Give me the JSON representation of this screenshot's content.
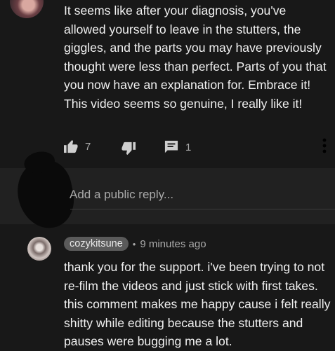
{
  "comment": {
    "text": "It seems like after your diagnosis, you've allowed yourself to leave in the stutters, the giggles, and the parts you may have previously thought were less than perfect. Parts of you that you now have an explanation for. Embrace it! This video seems so genuine, I really like it!",
    "likes": "7",
    "replies": "1"
  },
  "reply_box": {
    "placeholder": "Add a public reply..."
  },
  "reply": {
    "username": "cozykitsune",
    "separator": "•",
    "time": "9 minutes ago",
    "text": "thank you for the support. i've been trying to not re-film the videos and just stick with first takes. this comment makes me happy cause i felt really shitty while editing because the stutters and pauses were bugging me a lot."
  },
  "icons": [
    "like-icon",
    "dislike-icon",
    "reply-icon",
    "more-vert-icon"
  ]
}
